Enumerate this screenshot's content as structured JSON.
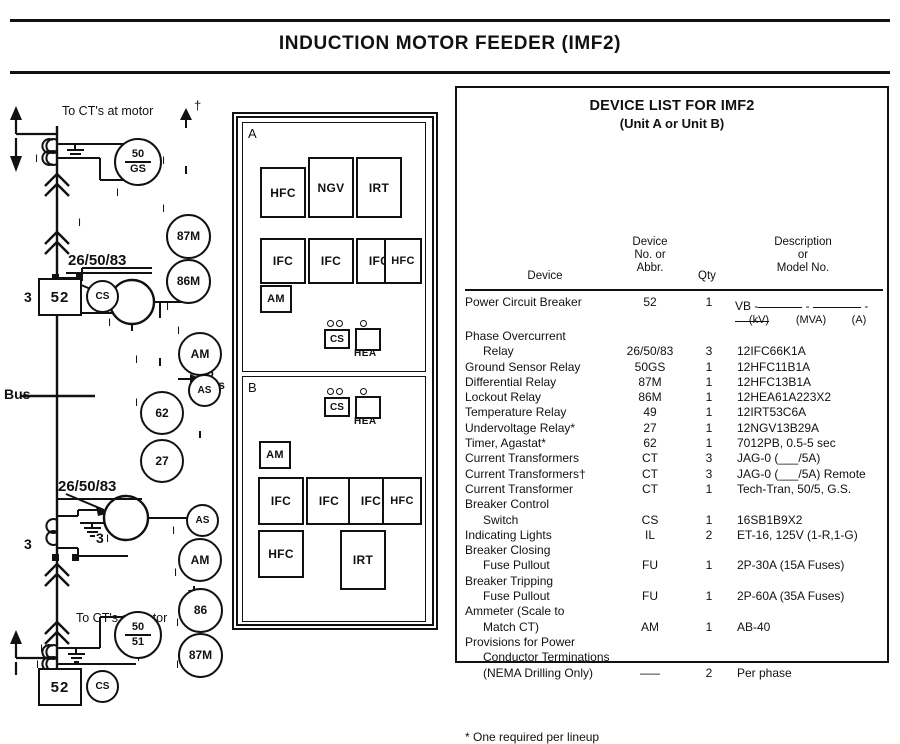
{
  "page": {
    "title": "INDUCTION MOTOR FEEDER  (IMF2)"
  },
  "device_table": {
    "title": "DEVICE LIST FOR IMF2",
    "subtitle": "(Unit A or Unit B)",
    "headers": {
      "device": "Device",
      "number": "Device\nNo. or\nAbbr.",
      "qty": "Qty",
      "description": "Description\nor\nModel No."
    },
    "first_row": {
      "device": "Power Circuit Breaker",
      "number": "52",
      "qty": "1",
      "desc_prefix": "VB -",
      "unit_kv": "(kV)",
      "unit_mva": "(MVA)",
      "unit_a": "(A)"
    },
    "rows": [
      {
        "device": "Phase Overcurrent",
        "indent": false,
        "number": "",
        "qty": "",
        "desc": ""
      },
      {
        "device": "Relay",
        "indent": true,
        "number": "26/50/83",
        "qty": "3",
        "desc": "12IFC66K1A"
      },
      {
        "device": "Ground Sensor Relay",
        "indent": false,
        "number": "50GS",
        "qty": "1",
        "desc": "12HFC11B1A"
      },
      {
        "device": "Differential Relay",
        "indent": false,
        "number": "87M",
        "qty": "1",
        "desc": "12HFC13B1A"
      },
      {
        "device": "Lockout Relay",
        "indent": false,
        "number": "86M",
        "qty": "1",
        "desc": "12HEA61A223X2"
      },
      {
        "device": "Temperature Relay",
        "indent": false,
        "number": "49",
        "qty": "1",
        "desc": "12IRT53C6A"
      },
      {
        "device": "Undervoltage Relay*",
        "indent": false,
        "number": "27",
        "qty": "1",
        "desc": "12NGV13B29A"
      },
      {
        "device": "Timer, Agastat*",
        "indent": false,
        "number": "62",
        "qty": "1",
        "desc": "7012PB, 0.5-5 sec"
      },
      {
        "device": "Current Transformers",
        "indent": false,
        "number": "CT",
        "qty": "3",
        "desc": "JAG-0 (___/5A)"
      },
      {
        "device": "Current Transformers†",
        "indent": false,
        "number": "CT",
        "qty": "3",
        "desc": "JAG-0 (___/5A) Remote"
      },
      {
        "device": "Current Transformer",
        "indent": false,
        "number": "CT",
        "qty": "1",
        "desc": "Tech-Tran, 50/5, G.S."
      },
      {
        "device": "Breaker Control",
        "indent": false,
        "number": "",
        "qty": "",
        "desc": ""
      },
      {
        "device": "Switch",
        "indent": true,
        "number": "CS",
        "qty": "1",
        "desc": "16SB1B9X2"
      },
      {
        "device": "Indicating Lights",
        "indent": false,
        "number": "IL",
        "qty": "2",
        "desc": "ET-16, 125V (1-R,1-G)"
      },
      {
        "device": "Breaker Closing",
        "indent": false,
        "number": "",
        "qty": "",
        "desc": ""
      },
      {
        "device": "Fuse Pullout",
        "indent": true,
        "number": "FU",
        "qty": "1",
        "desc": "2P-30A (15A Fuses)"
      },
      {
        "device": "Breaker Tripping",
        "indent": false,
        "number": "",
        "qty": "",
        "desc": ""
      },
      {
        "device": "Fuse Pullout",
        "indent": true,
        "number": "FU",
        "qty": "1",
        "desc": "2P-60A (35A Fuses)"
      },
      {
        "device": "Ammeter (Scale to",
        "indent": false,
        "number": "",
        "qty": "",
        "desc": ""
      },
      {
        "device": "Match CT)",
        "indent": true,
        "number": "AM",
        "qty": "1",
        "desc": "AB-40"
      },
      {
        "device": "Provisions for Power",
        "indent": false,
        "number": "",
        "qty": "",
        "desc": ""
      },
      {
        "device": "Conductor Terminations",
        "indent": true,
        "number": "",
        "qty": "",
        "desc": ""
      },
      {
        "device": "(NEMA Drilling Only)",
        "indent": true,
        "number": "–––",
        "qty": "2",
        "desc": "Per phase"
      }
    ],
    "footnote": "* One required per lineup"
  },
  "panel": {
    "unit_a_letter": "A",
    "unit_b_letter": "B",
    "unit_a_devices": [
      {
        "label": "HFC"
      },
      {
        "label": "NGV"
      },
      {
        "label": "IRT"
      },
      {
        "label": "IFC"
      },
      {
        "label": "IFC"
      },
      {
        "label": "IFC"
      },
      {
        "label": "HFC"
      },
      {
        "label": "AM"
      }
    ],
    "unit_a_cs": "CS",
    "unit_a_hea": "HEA",
    "unit_b_devices": [
      {
        "label": "AM"
      },
      {
        "label": "IFC"
      },
      {
        "label": "IFC"
      },
      {
        "label": "IFC"
      },
      {
        "label": "HFC"
      },
      {
        "label": "HFC"
      },
      {
        "label": "IRT"
      }
    ],
    "unit_b_cs": "CS",
    "unit_b_hea": "HEA"
  },
  "schematic": {
    "label_top_cts": "To CT's at motor",
    "label_top_dagger": "†",
    "label_bottom_cts": "To CT's at motor",
    "label_bus": "Bus",
    "label_to_pts_1": "To",
    "label_to_pts_2": "PT's",
    "label_phase_count_top": "3",
    "label_phase_count_mid_a": "3",
    "label_phase_count_mid_b": "3",
    "relay_50gs_top": "50",
    "relay_50gs_bot": "GS",
    "relay_5051_top": "50",
    "relay_5051_bot": "51",
    "breaker_top": "52",
    "breaker_bottom": "52",
    "cs_top": "CS",
    "cs_bottom": "CS",
    "relay_87m_top": "87M",
    "relay_86m_top": "86M",
    "relay_86_bottom": "86",
    "relay_87m_bottom": "87M",
    "relay_am_top": "AM",
    "relay_as_top": "AS",
    "relay_am_bottom": "AM",
    "relay_as_bottom": "AS",
    "relay_62": "62",
    "relay_27": "27",
    "overcurrent_label_top": "26/50/83",
    "overcurrent_label_bottom": "26/50/83"
  }
}
